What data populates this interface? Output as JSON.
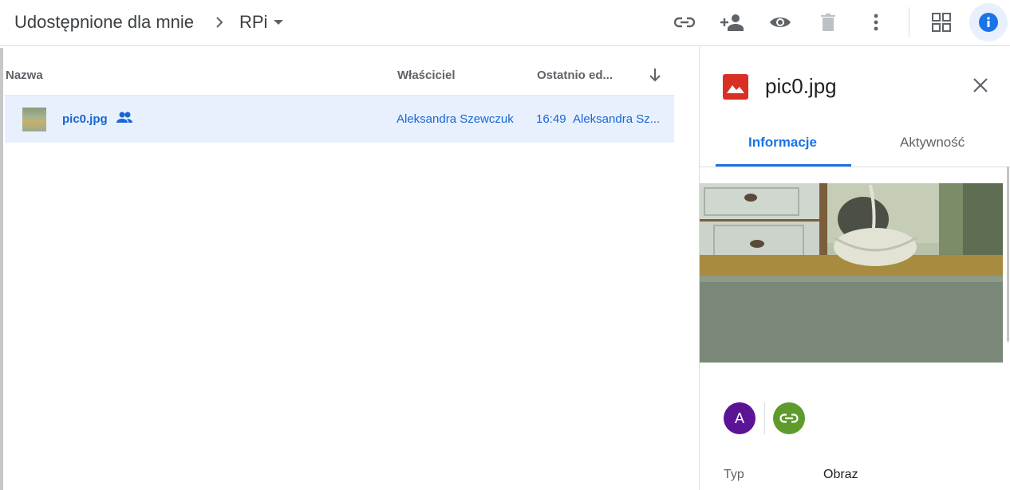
{
  "breadcrumb": {
    "root": "Udostępnione dla mnie",
    "current": "RPi"
  },
  "toolbar": {
    "icons": [
      "link-icon",
      "add-person-icon",
      "preview-icon",
      "trash-icon",
      "more-vert-icon",
      "grid-view-icon",
      "info-icon"
    ]
  },
  "list": {
    "columns": {
      "name": "Nazwa",
      "owner": "Właściciel",
      "modified": "Ostatnio ed..."
    },
    "rows": [
      {
        "name": "pic0.jpg",
        "owner": "Aleksandra Szewczuk",
        "time": "16:49",
        "modified_by": "Aleksandra Sz..."
      }
    ]
  },
  "panel": {
    "title": "pic0.jpg",
    "tabs": [
      "Informacje",
      "Aktywność"
    ],
    "avatar_letter": "A",
    "meta": [
      {
        "label": "Typ",
        "value": "Obraz"
      }
    ]
  },
  "colors": {
    "accent": "#1a73e8",
    "selected_row": "#e8f0fe",
    "image_icon": "#d93025",
    "avatar": "#5b1496",
    "link": "#5e9b2c"
  }
}
